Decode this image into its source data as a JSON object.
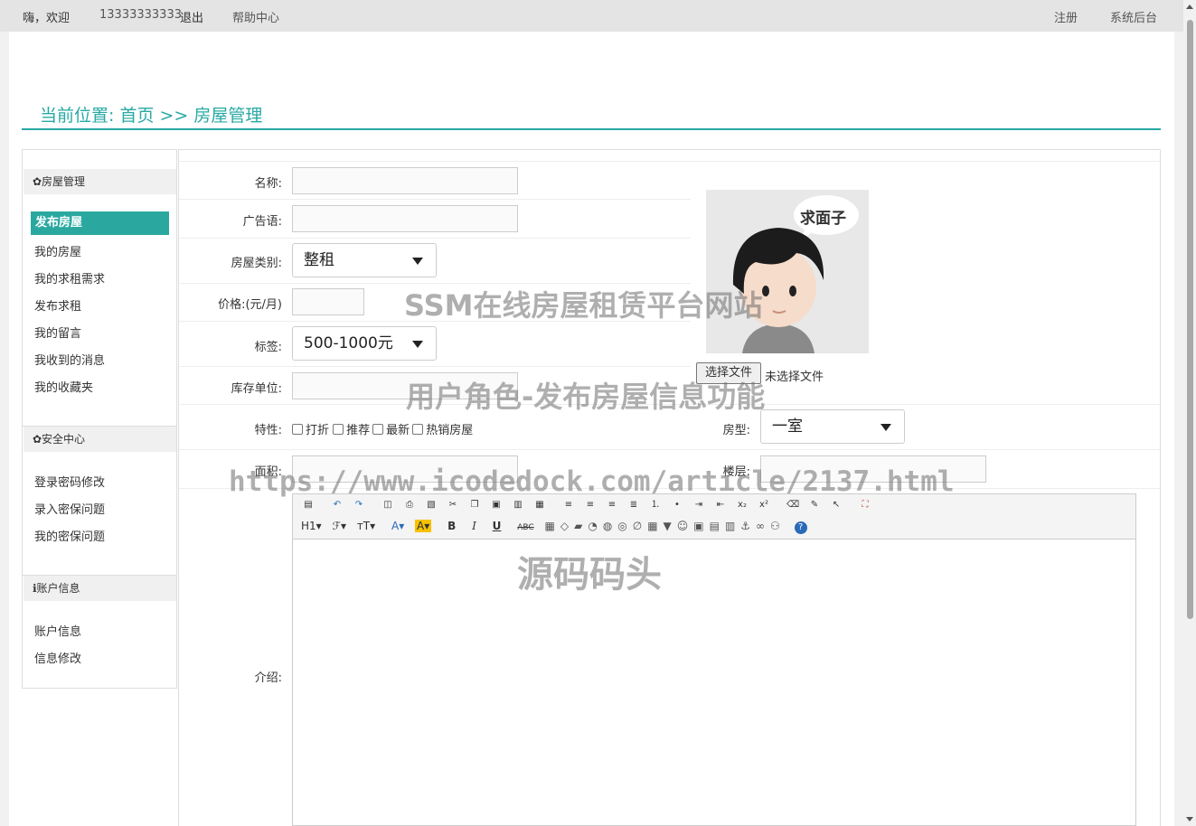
{
  "topbar": {
    "greeting": "嗨，欢迎",
    "user_phone": "13333333333",
    "logout": "退出",
    "help": "帮助中心",
    "register": "注册",
    "admin": "系统后台"
  },
  "breadcrumb": {
    "text": "当前位置: 首页 >> 房屋管理"
  },
  "sidebar": {
    "sections": [
      {
        "title": "✿房屋管理",
        "items": [
          "发布房屋",
          "我的房屋",
          "我的求租需求",
          "发布求租",
          "我的留言",
          "我收到的消息",
          "我的收藏夹"
        ]
      },
      {
        "title": "✿安全中心",
        "items": [
          "登录密码修改",
          "录入密保问题",
          "我的密保问题"
        ]
      },
      {
        "title": "ℹ账户信息",
        "items": [
          "账户信息",
          "信息修改"
        ]
      }
    ],
    "active_item": "发布房屋"
  },
  "form": {
    "name_label": "名称:",
    "name_value": "",
    "slogan_label": "广告语:",
    "slogan_value": "",
    "category_label": "房屋类别:",
    "category_value": "整租",
    "price_label": "价格:(元/月)",
    "price_value": "",
    "tag_label": "标签:",
    "tag_value": "500-1000元",
    "stock_label": "库存单位:",
    "stock_value": "",
    "feature_label": "特性:",
    "features": [
      "打折",
      "推荐",
      "最新",
      "热销房屋"
    ],
    "room_type_label": "房型:",
    "room_type_value": "一室",
    "area_label": "面积:",
    "area_value": "",
    "floor_label": "楼层:",
    "floor_value": "",
    "intro_label": "介绍:",
    "file_button": "选择文件",
    "file_status": "未选择文件",
    "avatar_bubble": "求面子"
  },
  "editor": {
    "row1_icons": [
      "source-icon",
      "undo-icon",
      "redo-icon",
      "preview-icon",
      "print-icon",
      "template-icon",
      "cut-icon",
      "copy-icon",
      "paste-icon",
      "paste-text-icon",
      "paste-word-icon",
      "align-left-icon",
      "align-center-icon",
      "align-right-icon",
      "justify-icon",
      "ordered-list-icon",
      "unordered-list-icon",
      "indent-icon",
      "outdent-icon",
      "subscript-icon",
      "superscript-icon",
      "clear-format-icon",
      "spellcheck-icon",
      "select-all-icon",
      "fullscreen-icon"
    ],
    "row2_labels": [
      "H1▾",
      "ℱ▾",
      "тT▾",
      "A▾",
      "A▾",
      "B",
      "I",
      "U",
      "ABC"
    ]
  },
  "watermarks": {
    "line1": "SSM在线房屋租赁平台网站",
    "line2": "用户角色-发布房屋信息功能",
    "line3": "https://www.icodedock.com/article/2137.html",
    "line4": "源码码头"
  },
  "colors": {
    "accent": "#27a9a4",
    "topbar_bg": "#e4e4e4"
  }
}
